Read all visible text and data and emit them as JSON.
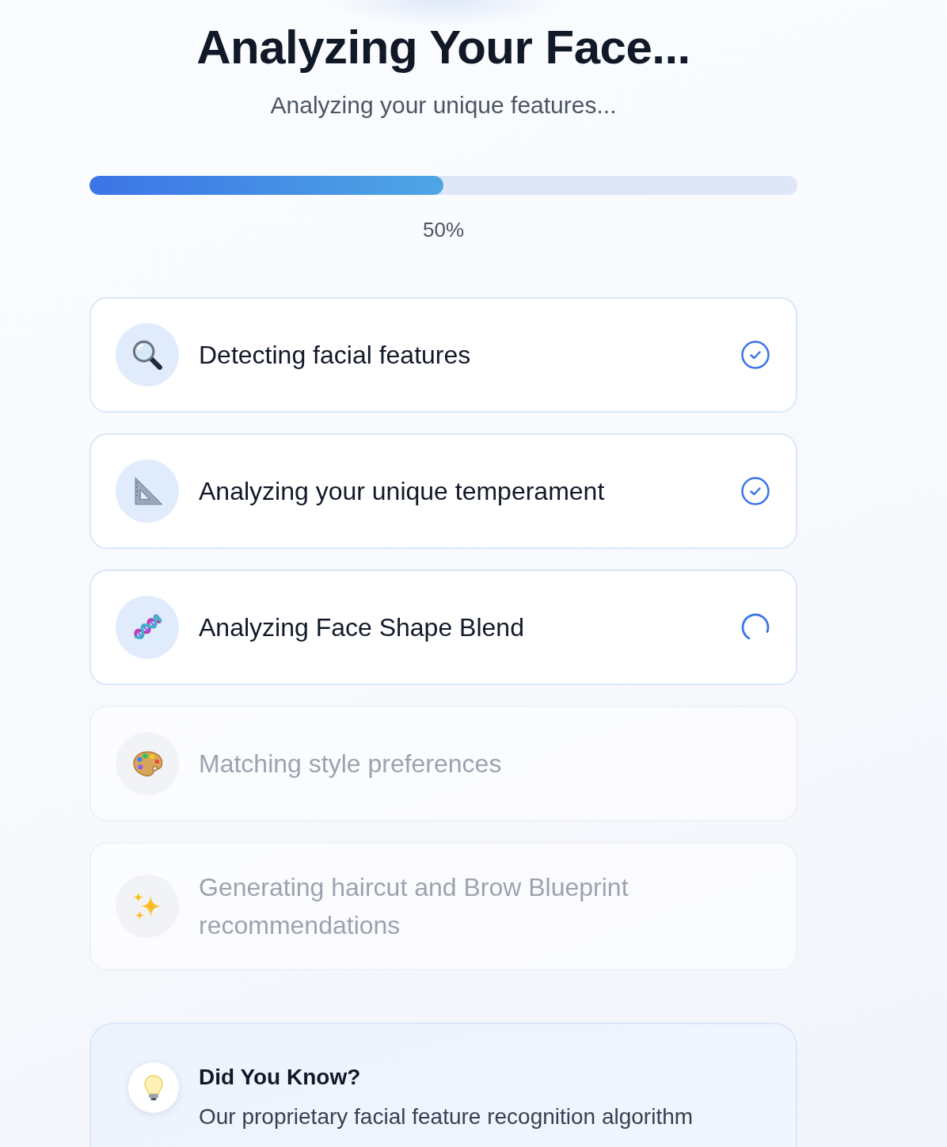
{
  "header": {
    "title": "Analyzing Your Face...",
    "subtitle": "Analyzing your unique features..."
  },
  "progress": {
    "level": 0.5,
    "percent": "50%"
  },
  "steps": [
    {
      "label": "Detecting facial features",
      "done": true,
      "active": false
    },
    {
      "label": "Analyzing your unique temperament",
      "done": true,
      "active": false
    },
    {
      "label": "Analyzing Face Shape Blend",
      "done": false,
      "active": true
    },
    {
      "label": "Matching style preferences",
      "done": false,
      "active": false
    },
    {
      "label": "Generating haircut and Brow Blueprint recommendations",
      "done": false,
      "active": false
    }
  ],
  "tip": {
    "title": "Did You Know?",
    "text": "Our proprietary facial feature recognition algorithm"
  }
}
